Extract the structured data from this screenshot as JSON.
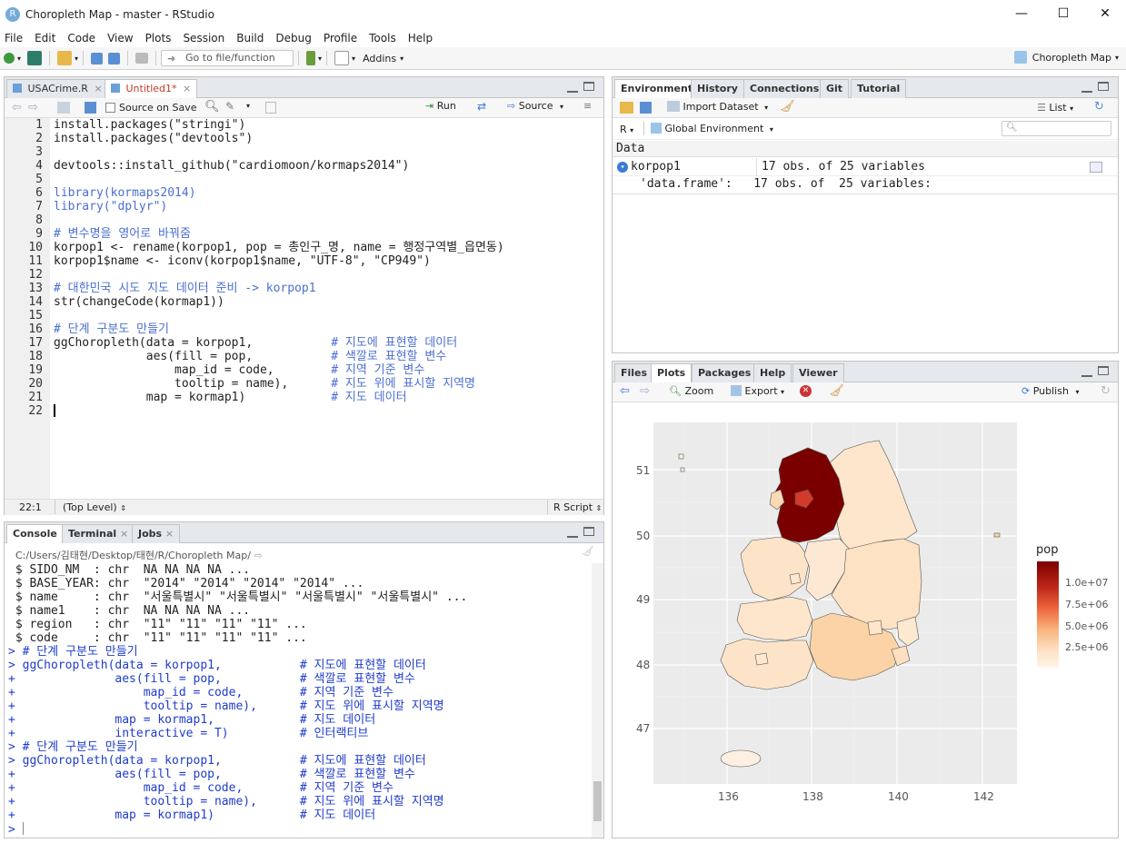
{
  "window": {
    "title": "Choropleth Map - master - RStudio",
    "app_icon": "R"
  },
  "menu": [
    "File",
    "Edit",
    "Code",
    "View",
    "Plots",
    "Session",
    "Build",
    "Debug",
    "Profile",
    "Tools",
    "Help"
  ],
  "toolbar": {
    "goto_placeholder": "Go to file/function",
    "addins": "Addins",
    "project": "Choropleth Map"
  },
  "editor": {
    "tabs": [
      "USACrime.R",
      "Untitled1*"
    ],
    "source_on_save": "Source on Save",
    "run": "Run",
    "source": "Source",
    "lines": [
      "install.packages(\"stringi\")",
      "install.packages(\"devtools\")",
      "",
      "devtools::install_github(\"cardiomoon/kormaps2014\")",
      "",
      "library(kormaps2014)",
      "library(\"dplyr\")",
      "",
      "# 변수명을 영어로 바꿔줌",
      "korpop1 <- rename(korpop1, pop = 총인구_명, name = 행정구역별_읍면동)",
      "korpop1$name <- iconv(korpop1$name, \"UTF-8\", \"CP949\")",
      "",
      "# 대한민국 시도 지도 데이터 준비 -> korpop1",
      "str(changeCode(kormap1))",
      "",
      "# 단계 구분도 만들기",
      "ggChoropleth(data = korpop1,           # 지도에 표현할 데이터",
      "             aes(fill = pop,           # 색깔로 표현할 변수",
      "                 map_id = code,        # 지역 기준 변수",
      "                 tooltip = name),      # 지도 위에 표시할 지역명",
      "             map = kormap1)            # 지도 데이터",
      ""
    ],
    "line_numbers": [
      "1",
      "2",
      "3",
      "4",
      "5",
      "6",
      "7",
      "8",
      "9",
      "10",
      "11",
      "12",
      "13",
      "14",
      "15",
      "16",
      "17",
      "18",
      "19",
      "20",
      "21",
      "22"
    ],
    "status_pos": "22:1",
    "status_scope": "(Top Level)",
    "status_type": "R Script"
  },
  "console": {
    "tabs": [
      "Console",
      "Terminal",
      "Jobs"
    ],
    "path": "C:/Users/김태현/Desktop/태현/R/Choropleth Map/",
    "lines": [
      {
        "t": " $ SIDO_NM  : chr  NA NA NA NA ...",
        "c": "out"
      },
      {
        "t": " $ BASE_YEAR: chr  \"2014\" \"2014\" \"2014\" \"2014\" ...",
        "c": "out"
      },
      {
        "t": " $ name     : chr  \"서울특별시\" \"서울특별시\" \"서울특별시\" \"서울특별시\" ...",
        "c": "out"
      },
      {
        "t": " $ name1    : chr  NA NA NA NA ...",
        "c": "out"
      },
      {
        "t": " $ region   : chr  \"11\" \"11\" \"11\" \"11\" ...",
        "c": "out"
      },
      {
        "t": " $ code     : chr  \"11\" \"11\" \"11\" \"11\" ...",
        "c": "out"
      },
      {
        "t": "> # 단계 구분도 만들기",
        "c": "in"
      },
      {
        "t": "> ggChoropleth(data = korpop1,           # 지도에 표현할 데이터",
        "c": "in"
      },
      {
        "t": "+              aes(fill = pop,           # 색깔로 표현할 변수",
        "c": "in"
      },
      {
        "t": "+                  map_id = code,        # 지역 기준 변수",
        "c": "in"
      },
      {
        "t": "+                  tooltip = name),      # 지도 위에 표시할 지역명",
        "c": "in"
      },
      {
        "t": "+              map = kormap1,            # 지도 데이터",
        "c": "in"
      },
      {
        "t": "+              interactive = T)          # 인터랙티브",
        "c": "in"
      },
      {
        "t": "> # 단계 구분도 만들기",
        "c": "in"
      },
      {
        "t": "> ggChoropleth(data = korpop1,           # 지도에 표현할 데이터",
        "c": "in"
      },
      {
        "t": "+              aes(fill = pop,           # 색깔로 표현할 변수",
        "c": "in"
      },
      {
        "t": "+                  map_id = code,        # 지역 기준 변수",
        "c": "in"
      },
      {
        "t": "+                  tooltip = name),      # 지도 위에 표시할 지역명",
        "c": "in"
      },
      {
        "t": "+              map = kormap1)            # 지도 데이터",
        "c": "in"
      },
      {
        "t": "> ",
        "c": "in"
      }
    ]
  },
  "environment": {
    "tabs": [
      "Environment",
      "History",
      "Connections",
      "Git",
      "Tutorial"
    ],
    "import": "Import Dataset",
    "list": "List",
    "lang": "R",
    "scope": "Global Environment",
    "section": "Data",
    "var_name": "korpop1",
    "var_desc": "17 obs. of 25 variables",
    "var_detail": "'data.frame':   17 obs. of  25 variables:"
  },
  "files": {
    "tabs": [
      "Files",
      "Plots",
      "Packages",
      "Help",
      "Viewer"
    ],
    "zoom": "Zoom",
    "export": "Export",
    "publish": "Publish"
  },
  "plot": {
    "x_ticks": [
      "136",
      "138",
      "140",
      "142"
    ],
    "y_ticks": [
      "51",
      "50",
      "49",
      "48",
      "47"
    ],
    "legend_title": "pop",
    "legend_labels": [
      "1.0e+07",
      "7.5e+06",
      "5.0e+06",
      "2.5e+06"
    ],
    "colors": {
      "high": "#7a0000",
      "low": "#fff5e6"
    }
  }
}
